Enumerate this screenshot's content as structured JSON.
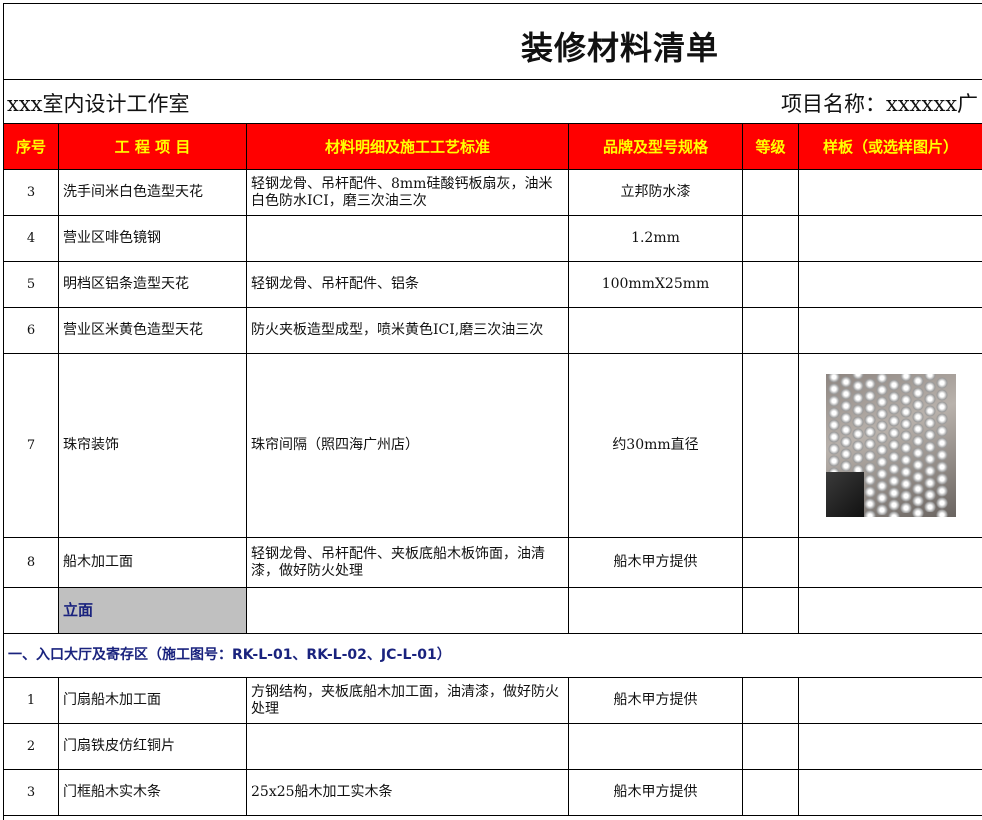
{
  "title": "装修材料清单",
  "studio": "xxx室内设计工作室",
  "project_label": "项目名称：xxxxxx广",
  "headers": {
    "no": "序号",
    "item": "工 程 项 目",
    "material": "材料明细及施工工艺标准",
    "brand": "品牌及型号规格",
    "grade": "等级",
    "sample": "样板（或选样图片）"
  },
  "rows": [
    {
      "no": "3",
      "item": "洗手间米白色造型天花",
      "material": "轻钢龙骨、吊杆配件、8mm硅酸钙板扇灰，油米白色防水ICI，磨三次油三次",
      "brand": "立邦防水漆"
    },
    {
      "no": "4",
      "item": "营业区啡色镜钢",
      "material": "",
      "brand": "1.2mm"
    },
    {
      "no": "5",
      "item": "明档区铝条造型天花",
      "material": "轻钢龙骨、吊杆配件、铝条",
      "brand": "100mmX25mm"
    },
    {
      "no": "6",
      "item": "营业区米黄色造型天花",
      "material": "防火夹板造型成型，喷米黄色ICI,磨三次油三次",
      "brand": ""
    },
    {
      "no": "7",
      "item": "珠帘装饰",
      "material": "珠帘间隔（照四海广州店）",
      "brand": "约30mm直径"
    },
    {
      "no": "8",
      "item": "船木加工面",
      "material": "轻钢龙骨、吊杆配件、夹板底船木板饰面，油清漆，做好防火处理",
      "brand": "船木甲方提供"
    }
  ],
  "subheader": "立面",
  "section_title": "一、入口大厅及寄存区（施工图号：RK-L-01、RK-L-02、JC-L-01）",
  "rows2": [
    {
      "no": "1",
      "item": "门扇船木加工面",
      "material": "方钢结构，夹板底船木加工面，油清漆，做好防火处理",
      "brand": "船木甲方提供"
    },
    {
      "no": "2",
      "item": "门扇铁皮仿红铜片",
      "material": "",
      "brand": ""
    },
    {
      "no": "3",
      "item": "门框船木实木条",
      "material": "25x25船木加工实木条",
      "brand": "船木甲方提供"
    }
  ],
  "sample_image": "bead-curtain-photo"
}
